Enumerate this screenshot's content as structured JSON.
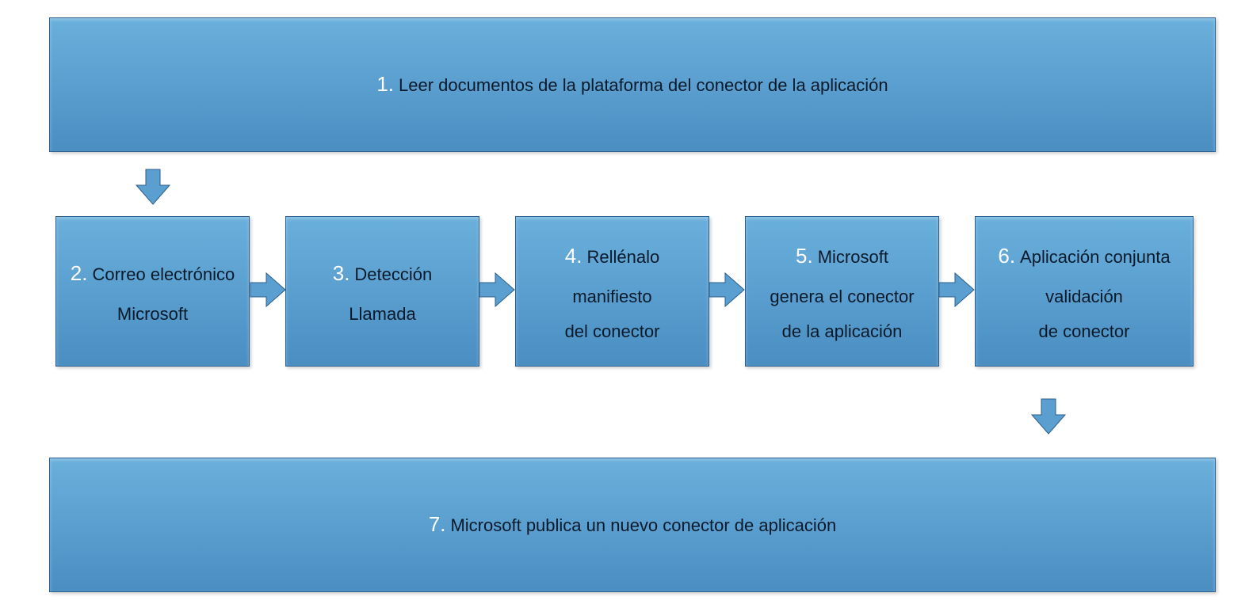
{
  "steps": {
    "s1": {
      "num": "1.",
      "text": "Leer documentos de la plataforma del conector de la aplicación"
    },
    "s2": {
      "num": "2.",
      "line1": "Correo electrónico",
      "line2": "Microsoft"
    },
    "s3": {
      "num": "3.",
      "line1": "Detección",
      "line2": "Llamada"
    },
    "s4": {
      "num": "4.",
      "line1": "Rellénalo",
      "line2": "manifiesto",
      "line3": "del conector"
    },
    "s5": {
      "num": "5.",
      "line1": "Microsoft",
      "line2": "genera el conector",
      "line3": "de la aplicación"
    },
    "s6": {
      "num": "6.",
      "line1": "Aplicación conjunta",
      "line2": "validación",
      "line3": "de conector"
    },
    "s7": {
      "num": "7.",
      "text": "Microsoft publica un nuevo conector de aplicación"
    }
  },
  "colors": {
    "fill": "#5a9fcf",
    "border": "#2c5f8d",
    "numColor": "#ffffff",
    "textColor": "#0a1a2a"
  }
}
